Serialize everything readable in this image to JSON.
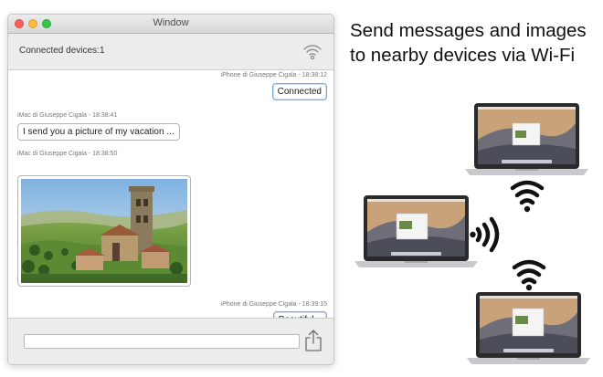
{
  "window": {
    "title": "Window",
    "connected_label": "Connected devices:",
    "connected_count": "1"
  },
  "messages": [
    {
      "sender": "iPhone di Giuseppe Cigala - 18:38:12",
      "text": "Connected",
      "side": "right"
    },
    {
      "sender": "iMac di Giuseppe Cigala - 18:38:41",
      "text": "I send you a picture of my vacation ...",
      "side": "left"
    },
    {
      "sender": "iMac di Giuseppe Cigala - 18:38:50",
      "text": "",
      "side": "left",
      "kind": "image"
    },
    {
      "sender": "iPhone di Giuseppe Cigala - 18:39:15",
      "text": "Beautiful...",
      "side": "right"
    }
  ],
  "composer": {
    "value": "",
    "placeholder": ""
  },
  "promo": {
    "headline_line1": "Send messages and images",
    "headline_line2": "to nearby devices via Wi-Fi"
  },
  "icons": {
    "status": "wifi-icon",
    "share": "share-icon",
    "broadcast": "wifi-broadcast-icon"
  },
  "colors": {
    "close": "#fc605c",
    "minimize": "#fdbc40",
    "maximize": "#34c84a",
    "bubble_mine_border": "#7aa7e0"
  }
}
